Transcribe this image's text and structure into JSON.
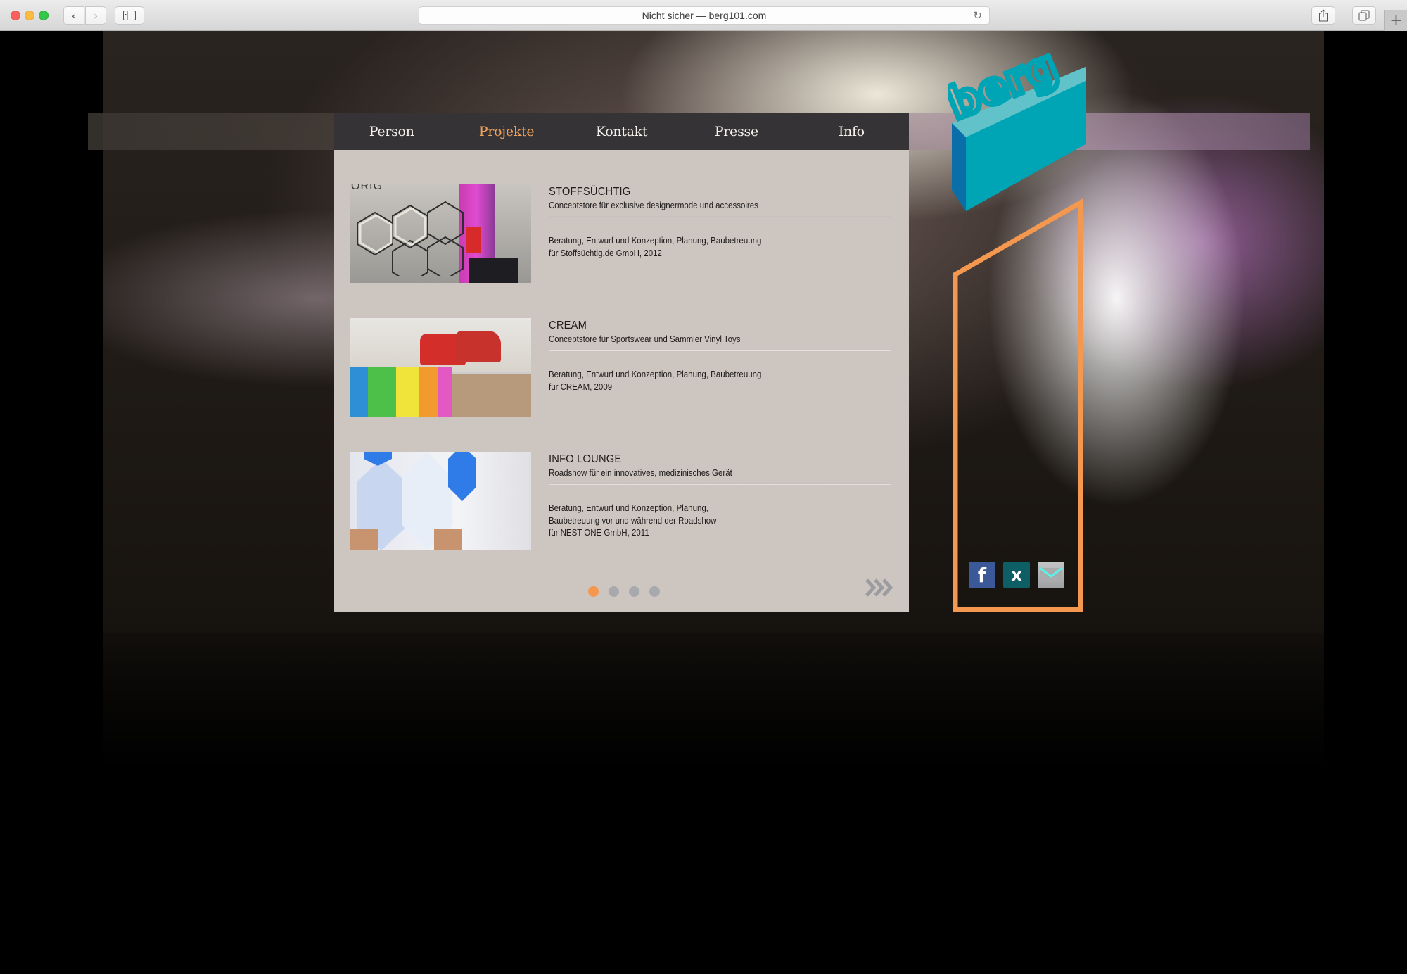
{
  "browser": {
    "url_display": "Nicht sicher — berg101.com",
    "icons": {
      "back": "chevron-left-icon",
      "forward": "chevron-right-icon",
      "sidebar": "sidebar-icon",
      "reload": "reload-icon",
      "share": "share-icon",
      "tabs": "tabs-overview-icon",
      "new_tab": "plus-icon"
    },
    "glyphs": {
      "back": "‹",
      "forward": "›",
      "reload": "↻",
      "share": "⇧",
      "tabs": "❐",
      "new_tab": "+"
    }
  },
  "nav": {
    "items": [
      {
        "label": "Person",
        "active": false
      },
      {
        "label": "Projekte",
        "active": true
      },
      {
        "label": "Kontakt",
        "active": false
      },
      {
        "label": "Presse",
        "active": false
      },
      {
        "label": "Info",
        "active": false
      }
    ]
  },
  "projects": [
    {
      "title": "STOFFSÜCHTIG",
      "subtitle": "Conceptstore für exclusive designermode und accessoires",
      "description": [
        "Beratung, Entwurf und Konzeption, Planung, Baubetreuung",
        "für Stoffsüchtig.de GmbH, 2012"
      ],
      "thumb_caption": "ORIG"
    },
    {
      "title": "CREAM",
      "subtitle": "Conceptstore für Sportswear und Sammler Vinyl Toys",
      "description": [
        "Beratung, Entwurf und Konzeption, Planung, Baubetreuung",
        "für CREAM, 2009"
      ]
    },
    {
      "title": "INFO LOUNGE",
      "subtitle": "Roadshow für ein innovatives, medizinisches Gerät",
      "description": [
        "Beratung, Entwurf und Konzeption, Planung,",
        "Baubetreuung vor und während der Roadshow",
        "für NEST ONE GmbH, 2011"
      ]
    }
  ],
  "pager": {
    "current_page": 1,
    "total_pages": 4,
    "next_glyph": "›››"
  },
  "brand": {
    "logo_text": "berg",
    "social": [
      {
        "name": "facebook",
        "glyph": "f"
      },
      {
        "name": "xing",
        "glyph": "x"
      },
      {
        "name": "email",
        "glyph": ""
      }
    ]
  },
  "colors": {
    "nav_bg": "#353335",
    "nav_active": "#f0a35a",
    "panel_bg": "#cdc5c0",
    "dot_active": "#f5974f",
    "dot_inactive": "#a8a9ad",
    "frame_orange": "#f5984f",
    "logo_teal": "#00a5b5",
    "logo_blue": "#0a6fa8"
  }
}
